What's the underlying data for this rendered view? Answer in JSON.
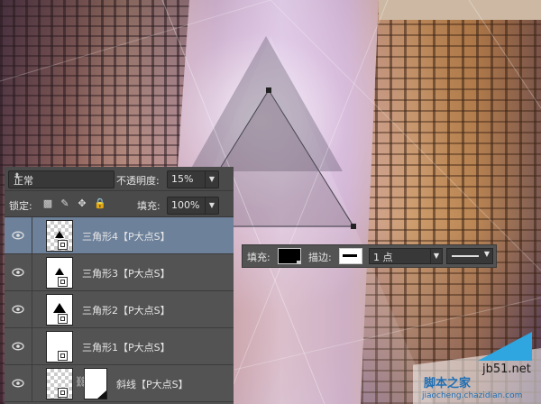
{
  "layers_panel": {
    "blend_mode": "正常",
    "opacity_label": "不透明度:",
    "opacity_value": "15%",
    "lock_label": "锁定:",
    "fill_label": "填充:",
    "fill_value": "100%",
    "layers": [
      {
        "name": "三角形4【P大点S】",
        "selected": true
      },
      {
        "name": "三角形3【P大点S】",
        "selected": false
      },
      {
        "name": "三角形2【P大点S】",
        "selected": false
      },
      {
        "name": "三角形1【P大点S】",
        "selected": false
      },
      {
        "name": "斜线【P大点S】",
        "selected": false
      }
    ]
  },
  "options_bar": {
    "fill_label": "填充:",
    "fill_color": "#000000",
    "stroke_label": "描边:",
    "stroke_width": "1 点"
  },
  "watermark": {
    "line1": "脚本之家",
    "line2": "jb51.net",
    "line3": "jiaocheng.chazidian.com"
  },
  "icons": [
    "eye-icon",
    "lock-transparent-pixels-icon",
    "lock-image-pixels-icon",
    "lock-position-icon",
    "lock-all-icon",
    "chevron-down-icon",
    "link-icon"
  ]
}
